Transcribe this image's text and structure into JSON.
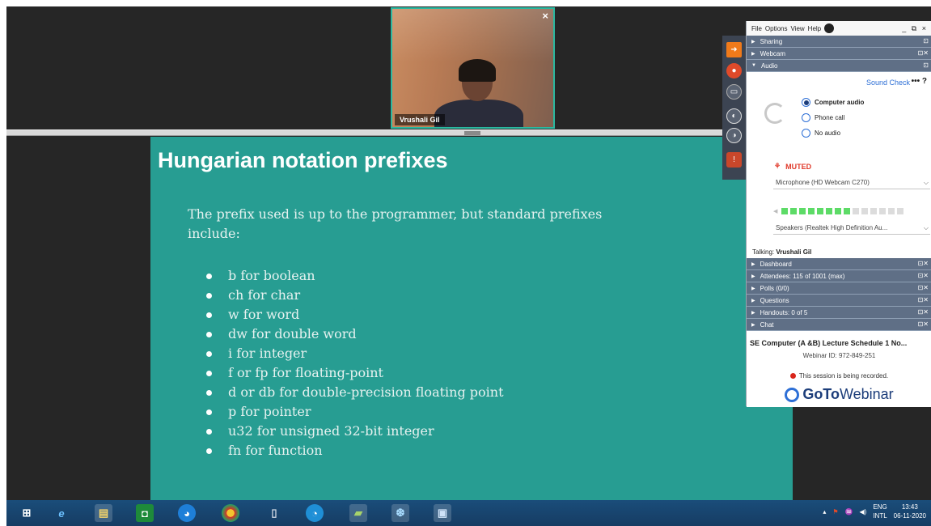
{
  "webcam": {
    "name": "Vrushali Gil",
    "close": "×"
  },
  "slide": {
    "title": "Hungarian notation prefixes",
    "intro": "The prefix used is up to the programmer, but standard prefixes include:",
    "bullets": [
      "b for boolean",
      "ch for char",
      "w for word",
      "dw for double word",
      "i for integer",
      "f or fp for floating-point",
      "d or db for double-precision floating point",
      "p for pointer",
      "u32 for unsigned 32-bit integer",
      "fn for function"
    ]
  },
  "panel": {
    "menu": [
      "File",
      "Options",
      "View",
      "Help"
    ],
    "window_buttons": "_ ⧉ ×",
    "sections_top": [
      "Sharing",
      "Webcam",
      "Audio"
    ],
    "audio": {
      "sound_check": "Sound Check",
      "more": "•••",
      "help": "?",
      "options": [
        "Computer audio",
        "Phone call",
        "No audio"
      ],
      "selected": 0,
      "muted_label": "MUTED",
      "microphone": "Microphone (HD Webcam C270)",
      "speakers": "Speakers (Realtek High Definition Au...",
      "level_on": 8,
      "level_total": 14,
      "talking_label": "Talking:",
      "talking_name": "Vrushali Gil"
    },
    "sections_bottom": [
      "Dashboard",
      "Attendees: 115 of 1001 (max)",
      "Polls (0/0)",
      "Questions",
      "Handouts: 0 of 5",
      "Chat"
    ],
    "footer": {
      "title": "SE Computer (A &B) Lecture Schedule 1 No...",
      "webinar_id": "Webinar ID: 972-849-251",
      "recording": "This session is being recorded.",
      "logo_bold": "GoTo",
      "logo_rest": "Webinar"
    }
  },
  "taskbar": {
    "lang_top": "ENG",
    "lang_bottom": "INTL",
    "time": "13:43",
    "date": "06-11-2020"
  }
}
